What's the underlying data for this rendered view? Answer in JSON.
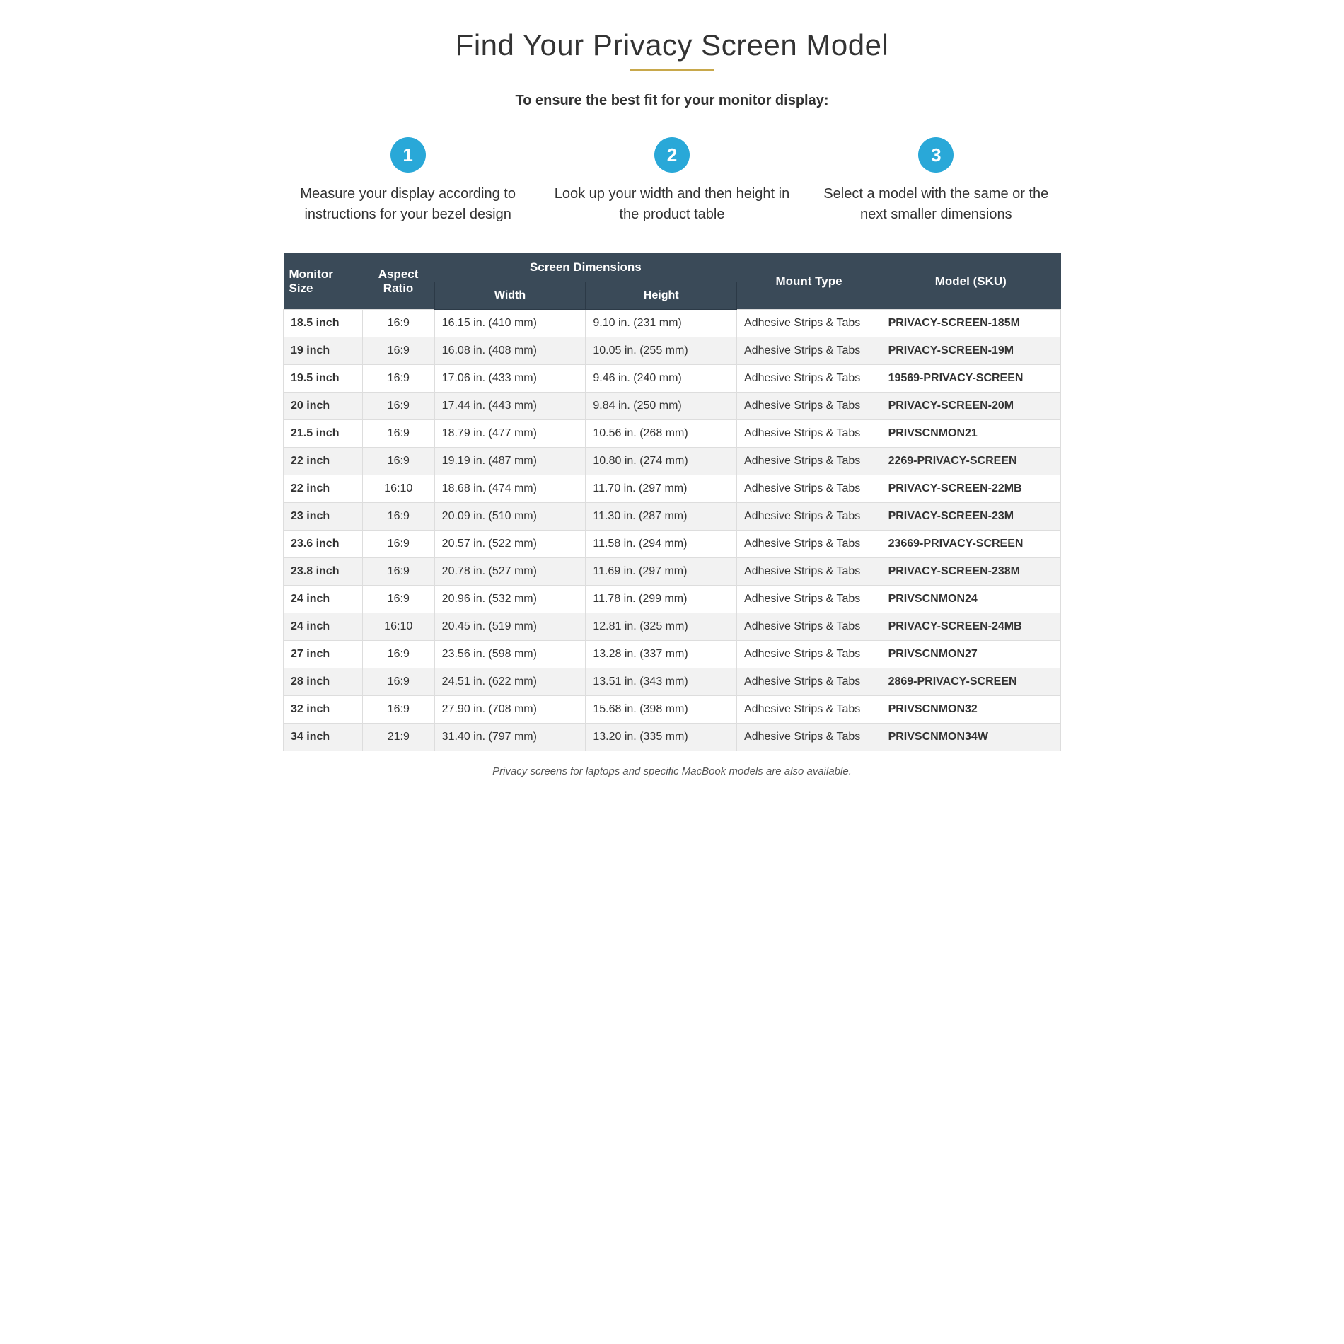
{
  "title": "Find Your Privacy Screen Model",
  "subtitle": "To ensure the best fit for your monitor display:",
  "gold_line": true,
  "steps": [
    {
      "number": "1",
      "text": "Measure your display according to instructions for your bezel design"
    },
    {
      "number": "2",
      "text": "Look up your width and then height in the product table"
    },
    {
      "number": "3",
      "text": "Select a model with the same or the next smaller dimensions"
    }
  ],
  "table": {
    "headers": {
      "col1": "Monitor Size",
      "col2": "Aspect Ratio",
      "screen_dimensions_group": "Screen Dimensions",
      "col3": "Width",
      "col4": "Height",
      "col5": "Mount Type",
      "col6": "Model (SKU)"
    },
    "rows": [
      {
        "size": "18.5 inch",
        "ratio": "16:9",
        "width": "16.15 in. (410 mm)",
        "height": "9.10 in. (231 mm)",
        "mount": "Adhesive Strips & Tabs",
        "sku": "PRIVACY-SCREEN-185M"
      },
      {
        "size": "19 inch",
        "ratio": "16:9",
        "width": "16.08 in. (408 mm)",
        "height": "10.05 in. (255 mm)",
        "mount": "Adhesive Strips & Tabs",
        "sku": "PRIVACY-SCREEN-19M"
      },
      {
        "size": "19.5 inch",
        "ratio": "16:9",
        "width": "17.06 in. (433 mm)",
        "height": "9.46 in. (240 mm)",
        "mount": "Adhesive Strips & Tabs",
        "sku": "19569-PRIVACY-SCREEN"
      },
      {
        "size": "20 inch",
        "ratio": "16:9",
        "width": "17.44 in. (443 mm)",
        "height": "9.84 in. (250 mm)",
        "mount": "Adhesive Strips & Tabs",
        "sku": "PRIVACY-SCREEN-20M"
      },
      {
        "size": "21.5 inch",
        "ratio": "16:9",
        "width": "18.79 in. (477 mm)",
        "height": "10.56 in. (268 mm)",
        "mount": "Adhesive Strips & Tabs",
        "sku": "PRIVSCNMON21"
      },
      {
        "size": "22 inch",
        "ratio": "16:9",
        "width": "19.19 in. (487 mm)",
        "height": "10.80 in. (274 mm)",
        "mount": "Adhesive Strips & Tabs",
        "sku": "2269-PRIVACY-SCREEN"
      },
      {
        "size": "22 inch",
        "ratio": "16:10",
        "width": "18.68 in. (474 mm)",
        "height": "11.70 in. (297 mm)",
        "mount": "Adhesive Strips & Tabs",
        "sku": "PRIVACY-SCREEN-22MB"
      },
      {
        "size": "23 inch",
        "ratio": "16:9",
        "width": "20.09 in. (510 mm)",
        "height": "11.30 in. (287 mm)",
        "mount": "Adhesive Strips & Tabs",
        "sku": "PRIVACY-SCREEN-23M"
      },
      {
        "size": "23.6 inch",
        "ratio": "16:9",
        "width": "20.57 in. (522 mm)",
        "height": "11.58 in. (294 mm)",
        "mount": "Adhesive Strips & Tabs",
        "sku": "23669-PRIVACY-SCREEN"
      },
      {
        "size": "23.8 inch",
        "ratio": "16:9",
        "width": "20.78 in. (527 mm)",
        "height": "11.69 in. (297 mm)",
        "mount": "Adhesive Strips & Tabs",
        "sku": "PRIVACY-SCREEN-238M"
      },
      {
        "size": "24 inch",
        "ratio": "16:9",
        "width": "20.96 in. (532 mm)",
        "height": "11.78 in. (299 mm)",
        "mount": "Adhesive Strips & Tabs",
        "sku": "PRIVSCNMON24"
      },
      {
        "size": "24 inch",
        "ratio": "16:10",
        "width": "20.45 in. (519 mm)",
        "height": "12.81 in. (325 mm)",
        "mount": "Adhesive Strips & Tabs",
        "sku": "PRIVACY-SCREEN-24MB"
      },
      {
        "size": "27 inch",
        "ratio": "16:9",
        "width": "23.56 in. (598 mm)",
        "height": "13.28 in. (337 mm)",
        "mount": "Adhesive Strips & Tabs",
        "sku": "PRIVSCNMON27"
      },
      {
        "size": "28 inch",
        "ratio": "16:9",
        "width": "24.51 in. (622 mm)",
        "height": "13.51 in. (343 mm)",
        "mount": "Adhesive Strips & Tabs",
        "sku": "2869-PRIVACY-SCREEN"
      },
      {
        "size": "32 inch",
        "ratio": "16:9",
        "width": "27.90 in. (708 mm)",
        "height": "15.68 in. (398 mm)",
        "mount": "Adhesive Strips & Tabs",
        "sku": "PRIVSCNMON32"
      },
      {
        "size": "34 inch",
        "ratio": "21:9",
        "width": "31.40 in. (797 mm)",
        "height": "13.20 in. (335 mm)",
        "mount": "Adhesive Strips & Tabs",
        "sku": "PRIVSCNMON34W"
      }
    ]
  },
  "footer": "Privacy screens for laptops and specific MacBook models are also available."
}
